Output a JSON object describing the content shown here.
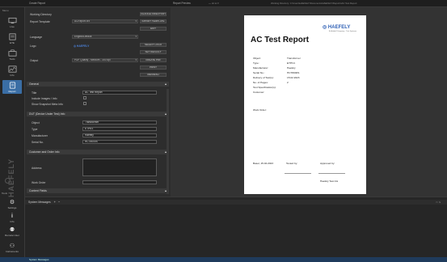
{
  "titlebar": {
    "left_title": "Create Report",
    "preview_title": "Report Preview",
    "right_info": "Working Directory: C:\\Users\\HAEFELY\\Documents\\HAEFELY\\Reports\\AC Test Report"
  },
  "sidebar": {
    "items": [
      {
        "label": "Live",
        "icon": "monitor-icon"
      },
      {
        "label": "ETE",
        "icon": "document-icon"
      },
      {
        "label": "Tools",
        "icon": "toolbox-icon"
      },
      {
        "label": "Info",
        "icon": "graph-icon"
      },
      {
        "label": "Report",
        "icon": "report-icon"
      }
    ],
    "brand": "HAEFELY",
    "bottom_section_label": "Tools",
    "bottom_items": [
      {
        "label": "Settings",
        "icon": "gear-icon"
      },
      {
        "label": "Info",
        "icon": "info-icon"
      },
      {
        "label": "Remote User",
        "icon": "user-icon"
      },
      {
        "label": "Instruments",
        "icon": "instruments-icon"
      }
    ]
  },
  "form": {
    "working_directory_label": "Working Directory",
    "report_template_label": "Report Template",
    "report_template_value": "ACReport.xrx",
    "language_label": "Language",
    "language_value": "English/Default",
    "logo_label": "Logo",
    "logo_text": "HAEFELY",
    "output_label": "Output",
    "output_value": "PDF Quality - Medium - 300 dpi",
    "buttons": {
      "change_directory": "CHANGE DIRECTORY",
      "import_template": "IMPORT TEMPLATE",
      "edit": "EDIT",
      "select_logo": "SELECT LOGO",
      "set_default": "SET DEFAULT",
      "create_pdf": "CREATE PDF",
      "print": "PRINT",
      "refresh": "REFRESH"
    }
  },
  "sections": {
    "general": {
      "title": "General",
      "title_label": "Title",
      "title_value": "AC Test Report",
      "include_images_label": "Include Images / Info",
      "show_snapshot_label": "Show Snapshot Meta Info"
    },
    "dut": {
      "title": "DUT (Device Under Test) Info",
      "object_label": "Object",
      "object_value": "Transformer",
      "type_label": "Type",
      "type_value": "ETHV1",
      "manufacturer_label": "Manufacturer",
      "manufacturer_value": "Haefely",
      "serial_label": "Serial No.",
      "serial_value": "HCT8000S"
    },
    "customer": {
      "title": "Customer and Order Info",
      "address_label": "Address",
      "work_order_label": "Work Order"
    },
    "content": {
      "title": "Content Fields"
    }
  },
  "report_page": {
    "logo": "HAEFELY",
    "logo_sub": "A Hubbell Company · Test Systems",
    "title": "AC Test Report",
    "fields": [
      {
        "label": "Object:",
        "value": "Transformer"
      },
      {
        "label": "Type:",
        "value": "ETHV1"
      },
      {
        "label": "Manufacturer:",
        "value": "Haefely"
      },
      {
        "label": "Serial No.:",
        "value": "HCT8000S"
      },
      {
        "label": "Delivery of Test(s):",
        "value": "15.02.2023"
      },
      {
        "label": "No. of Pages:",
        "value": "2"
      },
      {
        "label": "Test Specification(s):",
        "value": ""
      },
      {
        "label": "Customer:",
        "value": ""
      }
    ],
    "work_order_label": "Work Order:",
    "basel_label": "Basel, 15.02.2023",
    "tested_by_label": "Tested by:",
    "approved_by_label": "Approved by:",
    "company": "Haefely Test AG"
  },
  "bottom": {
    "panel_title": "System Messages",
    "add_symbol": "+",
    "minus_symbol": "−"
  },
  "statusbar": {
    "text": "System Messages"
  }
}
